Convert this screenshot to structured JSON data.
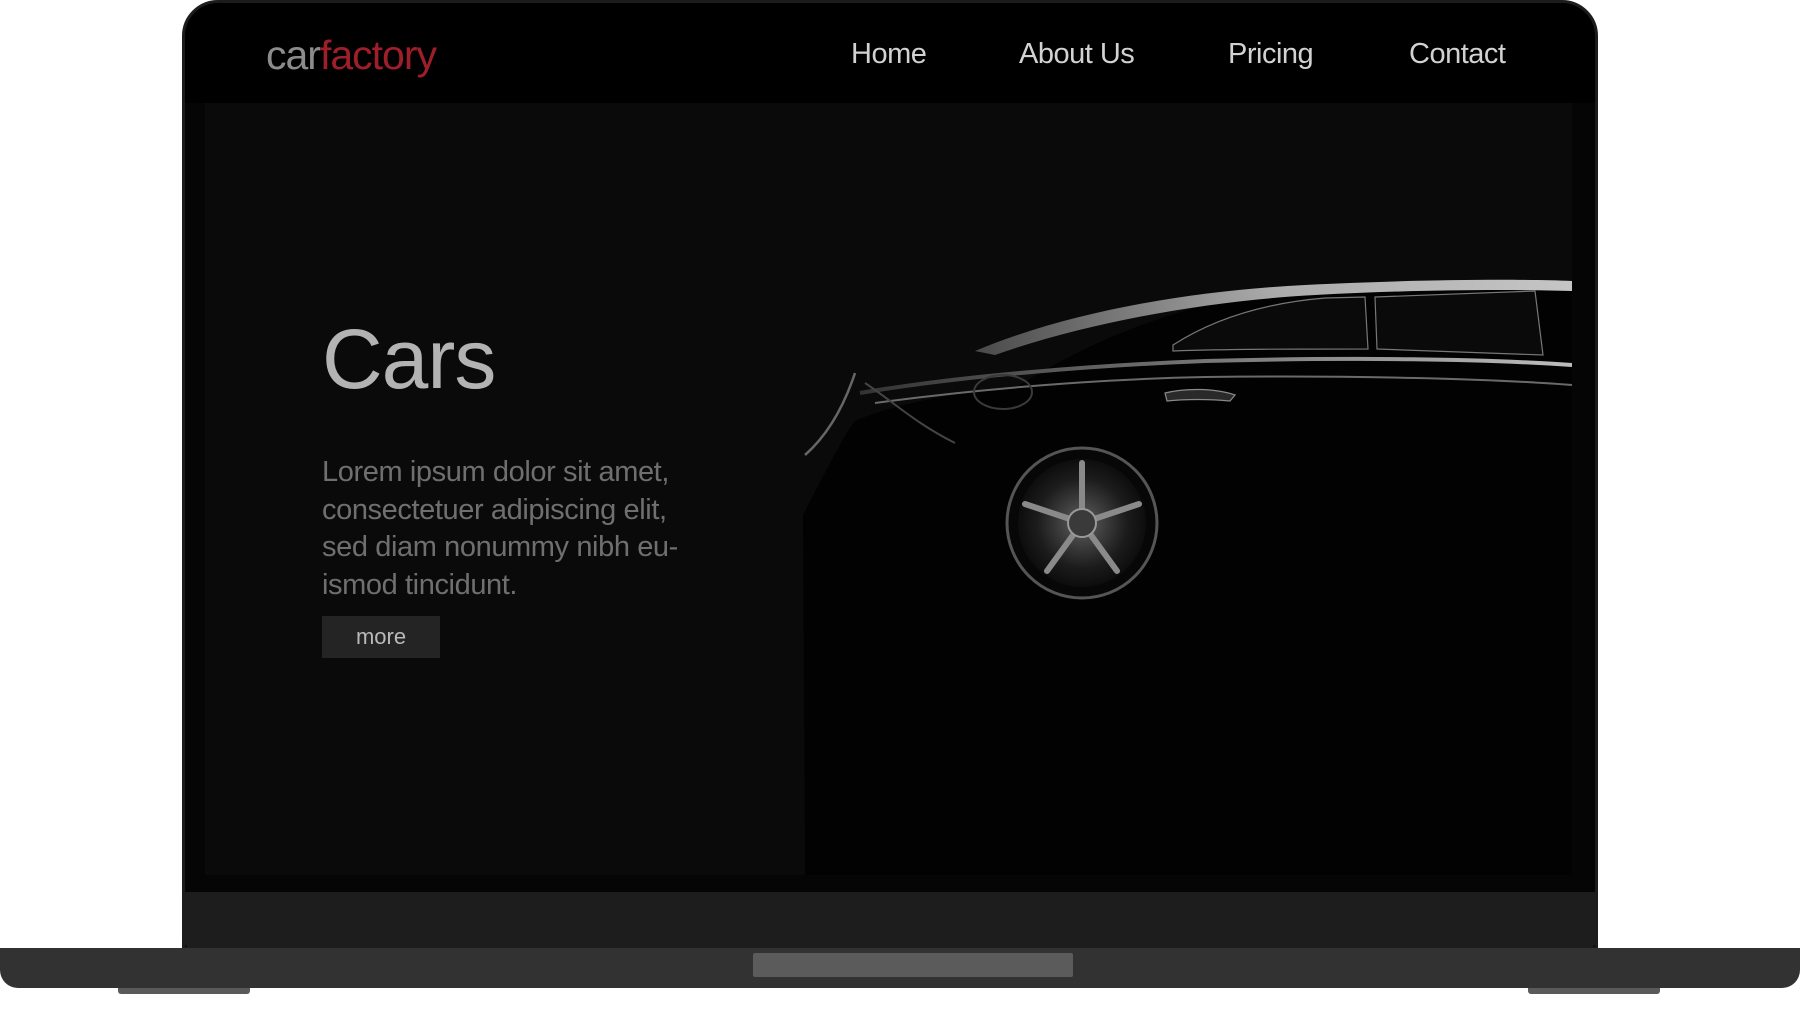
{
  "site": {
    "logo_prefix": "car",
    "logo_suffix": "factory",
    "accent_color": "#9e1e2a"
  },
  "nav": {
    "items": [
      "Home",
      "About Us",
      "Pricing",
      "Contact"
    ]
  },
  "hero": {
    "title": "Cars",
    "body": "Lorem ipsum dolor sit amet, consectetuer adipiscing elit, sed diam nonummy nibh eu-ismod tincidunt.",
    "button_label": "more"
  }
}
